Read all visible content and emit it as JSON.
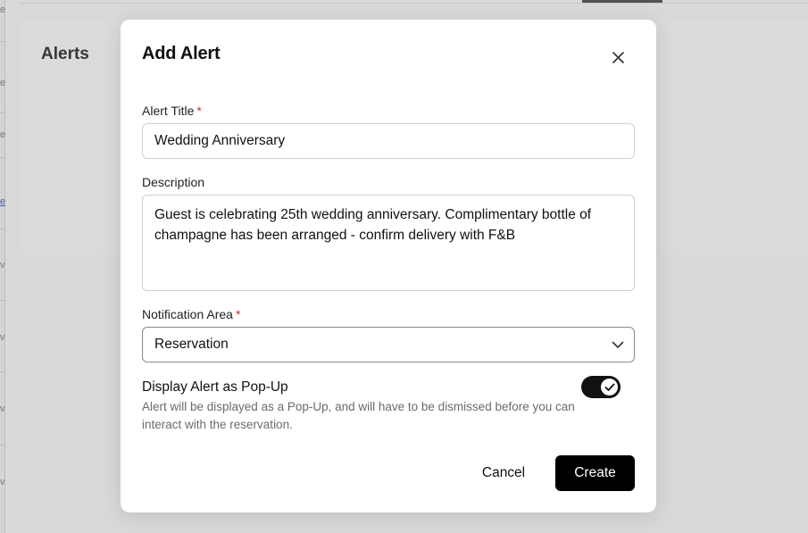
{
  "background": {
    "card_title": "Alerts",
    "side_chars": [
      "e",
      "e",
      "e",
      "e",
      "v",
      "v",
      "v",
      "v"
    ]
  },
  "modal": {
    "title": "Add Alert",
    "close_icon": "close-icon",
    "alert_title": {
      "label": "Alert Title",
      "required_mark": "*",
      "value": "Wedding Anniversary"
    },
    "description": {
      "label": "Description",
      "value": "Guest is celebrating 25th wedding anniversary. Complimentary bottle of champagne has been arranged - confirm delivery with F&B"
    },
    "notification_area": {
      "label": "Notification Area",
      "required_mark": "*",
      "value": "Reservation",
      "icon": "chevron-down-icon"
    },
    "popup_toggle": {
      "label": "Display Alert as Pop-Up",
      "help": "Alert will be displayed as a Pop-Up, and will have to be dismissed before you can interact with the reservation.",
      "enabled": true,
      "icon": "check-icon"
    },
    "buttons": {
      "cancel": "Cancel",
      "create": "Create"
    }
  },
  "colors": {
    "primary": "#000000",
    "required": "#d0342c",
    "help_text": "#6b6b6b"
  }
}
